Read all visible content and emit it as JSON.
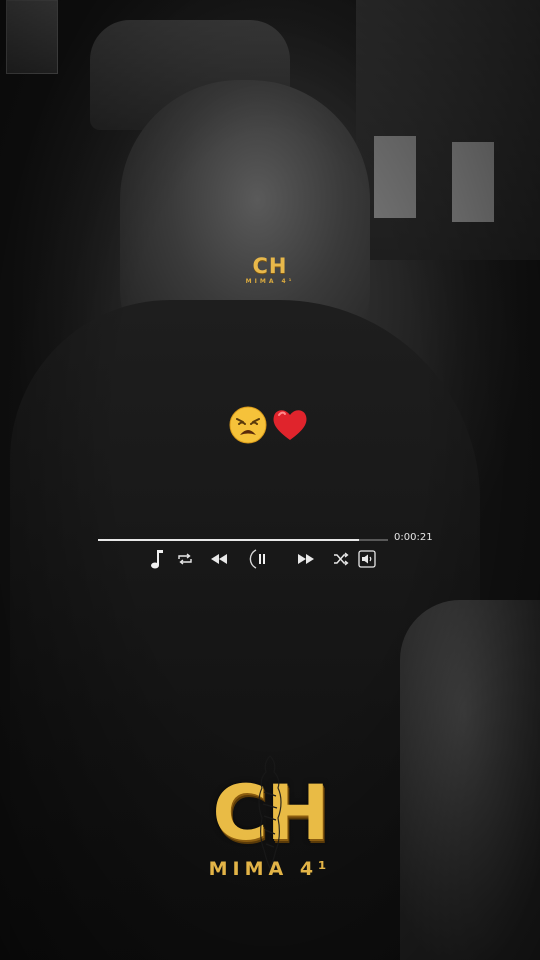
{
  "watermark_small": {
    "title": "CH",
    "subtitle": "MIMA 4¹"
  },
  "emojis": [
    "weary-face",
    "red-heart"
  ],
  "player": {
    "elapsed": "0:00:21",
    "progress": 0.9,
    "controls": [
      "music-note",
      "repeat",
      "previous",
      "pause",
      "next",
      "shuffle",
      "volume"
    ]
  },
  "watermark_large": {
    "title": "CH",
    "subtitle": "MIMA 4¹"
  },
  "colors": {
    "gold": "#e9bb45",
    "gold_dark": "#8a5c10",
    "heart": "#e0242c",
    "emoji_face": "#f6c23a",
    "ui_white": "#e8e8e8"
  }
}
